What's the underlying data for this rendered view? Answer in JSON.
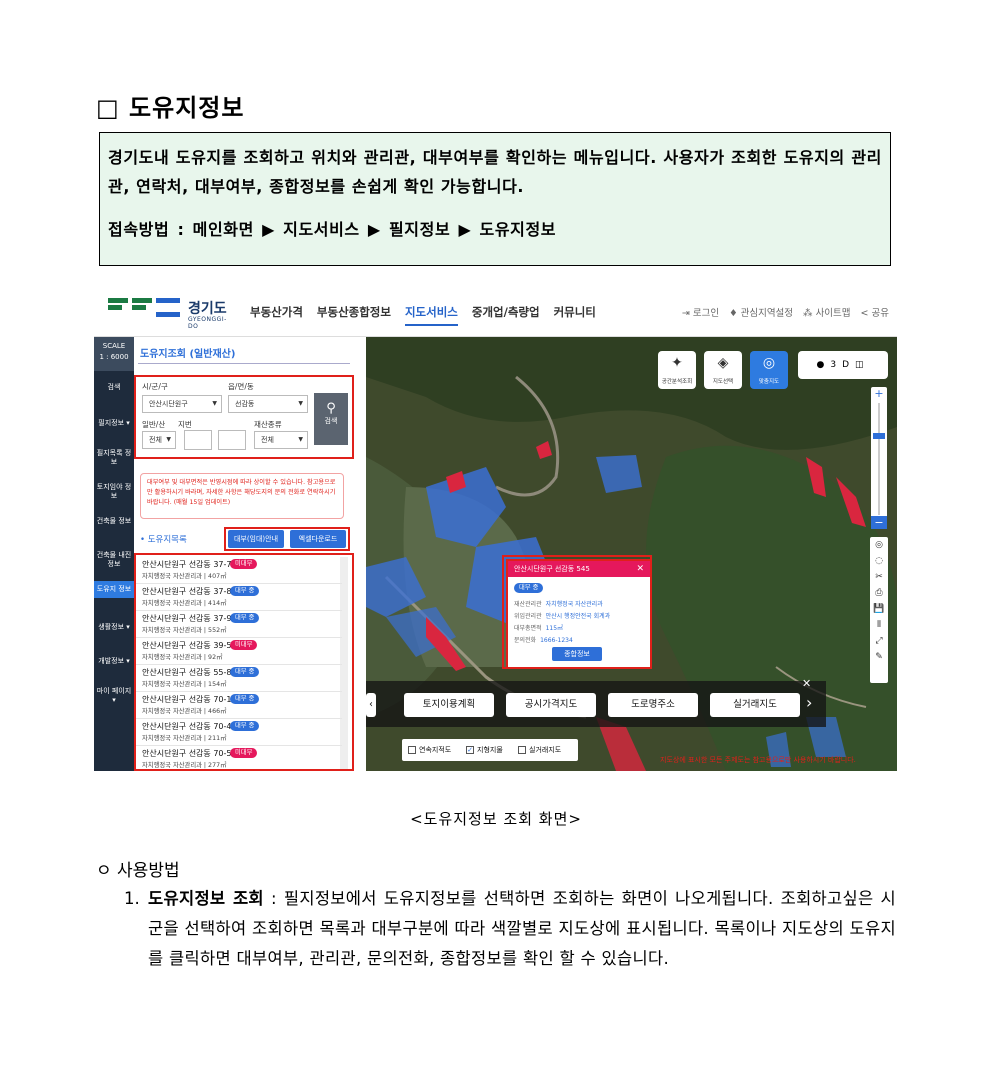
{
  "page": {
    "title": "□ 도유지정보",
    "info_box": {
      "line1": "경기도내 도유지를 조회하고 위치와 관리관, 대부여부를 확인하는 메뉴입니다. 사용자가 조회한 도유지의 관리관, 연락처, 대부여부, 종합정보를 손쉽게 확인 가능합니다.",
      "access": "접속방법 : 메인화면 ▶ 지도서비스 ▶ 필지정보 ▶ 도유지정보"
    },
    "caption": "<도유지정보 조회 화면>",
    "usage_heading": "ㅇ 사용방법",
    "step1": {
      "number": "1.",
      "bold": "도유지정보 조회",
      "text": " : 필지정보에서 도유지정보를 선택하면 조회하는 화면이 나오게됩니다. 조회하고싶은 시군을 선택하여 조회하면 목록과 대부구분에 따라 색깔별로 지도상에 표시됩니다. 목록이나 지도상의 도유지를 클릭하면 대부여부, 관리관, 문의전화, 종합정보를 확인 할 수 있습니다."
    }
  },
  "app": {
    "logo_text": "경기도",
    "logo_sub": "GYEONGGI-DO",
    "nav": [
      "부동산가격",
      "부동산종합정보",
      "지도서비스",
      "중개업/측량업",
      "커뮤니티"
    ],
    "util": [
      "⇥ 로그인",
      "♦ 관심지역설정",
      "⁂ 사이트맵",
      "< 공유"
    ],
    "scale": [
      "SCALE",
      "1 : 6000"
    ],
    "leftnav": [
      "검색",
      "필지정보 ▾",
      "필지목록 정보",
      "토지임야 정보",
      "건축물 정보",
      "건축물 내진정보",
      "도유지 정보",
      "생활정보 ▾",
      "개발정보 ▾",
      "마이 페이지 ▾"
    ],
    "panel": {
      "title": "도유지조회 (일반재산)",
      "label_sigungu": "시/군/구",
      "label_eup": "읍/면/동",
      "sigungu_value": "안산시단원구",
      "eup_value": "선감동",
      "label_general": "일반/산",
      "label_jibun": "지번",
      "label_type": "재산종류",
      "general_value": "전체",
      "type_value": "전체",
      "search": "검색",
      "warning": "대부여부 및 대부면적은 반영시점에 따라 상이할 수 있습니다. 참고용으로만 활용하시기 바라며, 자세한 사항은 해당도지의 문의 전화로 연락하시기 바랍니다. (매월 15일 업데이트)",
      "list_title": "• 도유지목록",
      "btn_guide": "대부(임대)안내",
      "btn_excel": "엑셀다운로드",
      "rows": [
        {
          "name": "안산시단원구 선감동 37-7",
          "sub": "자치행정국 자산관리과 | 407㎡",
          "badge": "미대부",
          "status": "red"
        },
        {
          "name": "안산시단원구 선감동 37-8",
          "sub": "자치행정국 자산관리과 | 414㎡",
          "badge": "대부 중",
          "status": "blue"
        },
        {
          "name": "안산시단원구 선감동 37-9",
          "sub": "자치행정국 자산관리과 | 552㎡",
          "badge": "대부 중",
          "status": "blue"
        },
        {
          "name": "안산시단원구 선감동 39-5",
          "sub": "자치행정국 자산관리과 | 92㎡",
          "badge": "미대부",
          "status": "red"
        },
        {
          "name": "안산시단원구 선감동 55-8",
          "sub": "자치행정국 자산관리과 | 154㎡",
          "badge": "대부 중",
          "status": "blue"
        },
        {
          "name": "안산시단원구 선감동 70-1",
          "sub": "자치행정국 자산관리과 | 466㎡",
          "badge": "대부 중",
          "status": "blue"
        },
        {
          "name": "안산시단원구 선감동 70-4",
          "sub": "자치행정국 자산관리과 | 211㎡",
          "badge": "대부 중",
          "status": "blue"
        },
        {
          "name": "안산시단원구 선감동 70-5",
          "sub": "자치행정국 자산관리과 | 277㎡",
          "badge": "미대부",
          "status": "red"
        }
      ]
    },
    "map": {
      "buttons": [
        "공간분석조회",
        "지도선택",
        "맞춤지도"
      ],
      "popup": {
        "title": "안산시단원구 선감동 545",
        "badge": "대부 중",
        "rows": [
          {
            "k": "재산관리관",
            "v": "자치행정국 자산관리과"
          },
          {
            "k": "위임관리관",
            "v": "안산시 행정안전국 회계과"
          },
          {
            "k": "대부총면적",
            "v": "115㎡"
          },
          {
            "k": "문의전화",
            "v": "1666-1234"
          }
        ],
        "button": "종합정보"
      },
      "layers": [
        "토지이용계획",
        "공시가격지도",
        "도로명주소",
        "실거래지도"
      ],
      "checks": [
        "연속지적도",
        "지형지물",
        "실거래지도"
      ],
      "disclaimer": "지도상에 표시한 모든 주제도는 참고용으로만 사용하시기 바랍니다."
    }
  }
}
